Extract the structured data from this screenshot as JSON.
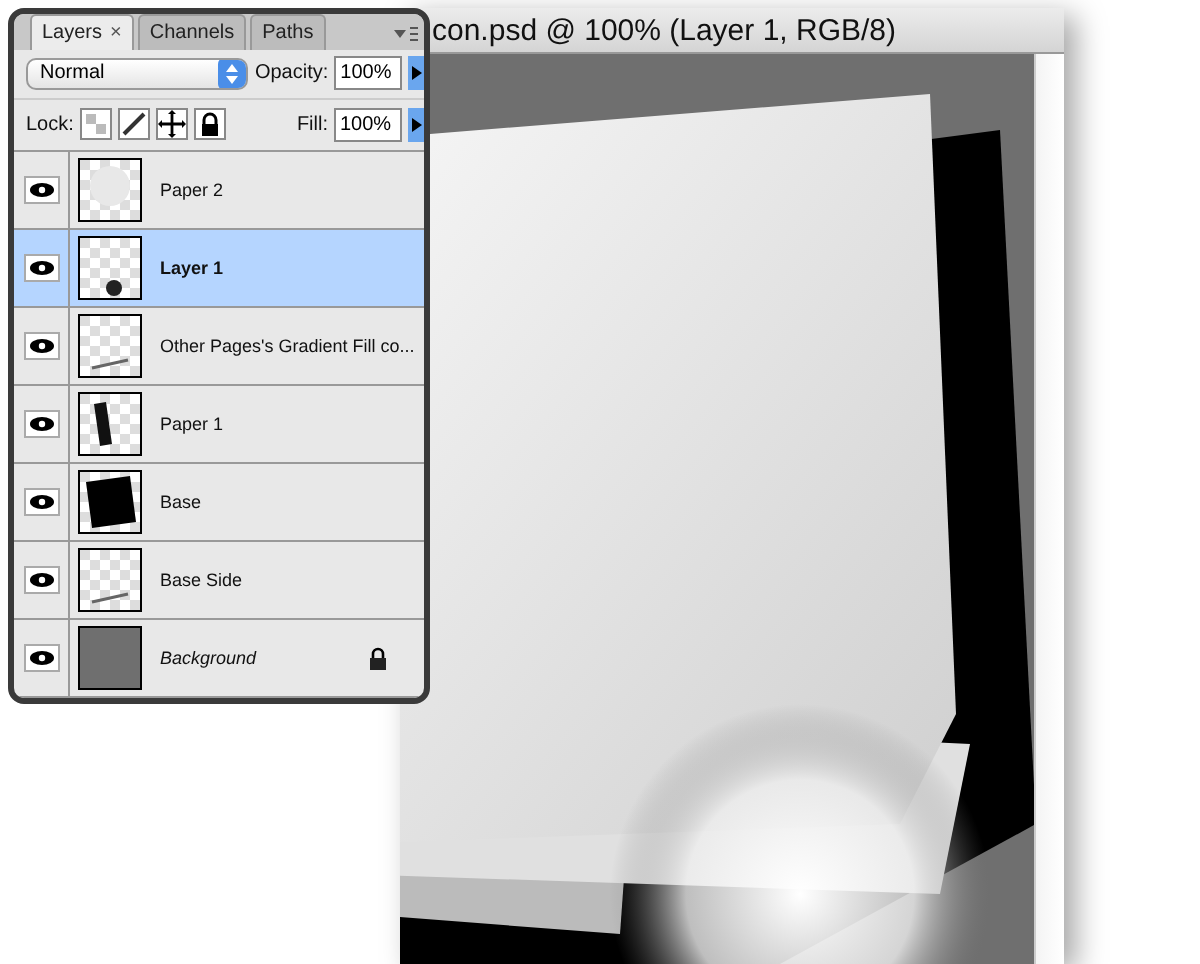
{
  "document": {
    "title": "con.psd @ 100% (Layer 1, RGB/8)"
  },
  "layers_panel": {
    "tabs": [
      {
        "label": "Layers",
        "selected": true,
        "close": "×"
      },
      {
        "label": "Channels",
        "selected": false
      },
      {
        "label": "Paths",
        "selected": false
      }
    ],
    "blend_mode": "Normal",
    "opacity": {
      "label": "Opacity:",
      "value": "100%"
    },
    "lock_label": "Lock:",
    "fill": {
      "label": "Fill:",
      "value": "100%"
    },
    "layers": [
      {
        "name": "Paper 2",
        "kind": "layer",
        "thumbnail": {
          "kind": "blob"
        },
        "visible": true,
        "selected": false,
        "locked": false
      },
      {
        "name": "Layer 1",
        "kind": "layer",
        "thumbnail": {
          "kind": "spot"
        },
        "visible": true,
        "selected": true,
        "locked": false
      },
      {
        "name": "Other Pages's Gradient Fill co...",
        "kind": "layer",
        "thumbnail": {
          "kind": "line"
        },
        "visible": true,
        "selected": false,
        "locked": false
      },
      {
        "name": "Paper 1",
        "kind": "layer",
        "thumbnail": {
          "kind": "bar"
        },
        "visible": true,
        "selected": false,
        "locked": false
      },
      {
        "name": "Base",
        "kind": "layer",
        "thumbnail": {
          "kind": "square"
        },
        "visible": true,
        "selected": false,
        "locked": false
      },
      {
        "name": "Base Side",
        "kind": "layer",
        "thumbnail": {
          "kind": "line"
        },
        "visible": true,
        "selected": false,
        "locked": false
      },
      {
        "name": "Background",
        "kind": "background",
        "thumbnail": {
          "kind": "solid"
        },
        "visible": true,
        "selected": false,
        "locked": true
      }
    ]
  }
}
